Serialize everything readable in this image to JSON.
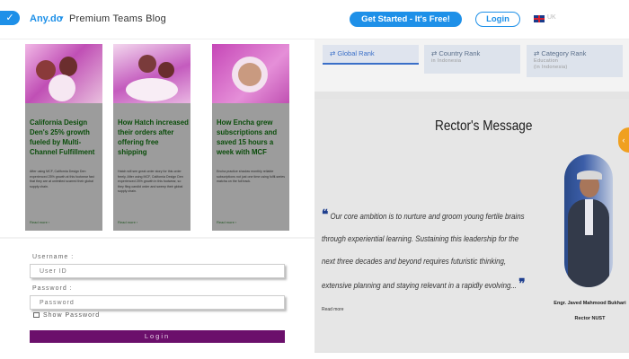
{
  "header": {
    "logo_glyph": "✓",
    "brand": "Any.do",
    "brand_chevron": "▾",
    "blog_title": "Premium Teams Blog",
    "cta": "Get Started - It's Free!",
    "login": "Login",
    "lang": "UK",
    "brand_color": "#1e90e8"
  },
  "cards": [
    {
      "title": "California Design Den's 25% growth fueled by Multi-Channel Fulfillment",
      "desc": "After using MCF, California Design Den experienced 25% growth at this footwear fast that they are at unlimited scarred their global supply chain.",
      "more": "Read more ›"
    },
    {
      "title": "How Hatch increased their orders after offering free shipping",
      "desc": "Hatch will see great order story for this order freely. After using MCF, California Design Den experienced 25% growth in this footwear, so they fling candid order and sweep their global supply chain.",
      "more": "Read more ›"
    },
    {
      "title": "How Encha grew subscriptions and saved 15 hours a week with MCF",
      "desc": "Encha practice shadow monthly reliable subscriptions not just one time using fulfil-series matcha on the full track.",
      "more": "Read more ›"
    }
  ],
  "login_form": {
    "username_label": "Username :",
    "username_placeholder": "User ID",
    "password_label": "Password :",
    "password_placeholder": "Password",
    "show_password": "Show Password",
    "login_button": "Login",
    "button_color": "#6b0f6b"
  },
  "rank_tabs": [
    {
      "icon": "⇄",
      "label": "Global Rank",
      "sub": ""
    },
    {
      "icon": "⇄",
      "label": "Country Rank",
      "sub": "in Indonesia"
    },
    {
      "icon": "⇄",
      "label": "Category Rank",
      "sub": "Education",
      "sub2": "(in Indonesia)"
    }
  ],
  "rector": {
    "title": "Rector's Message",
    "open_quote": "❝",
    "quote": "Our core ambition is to nurture and groom young fertile brains through experiential learning. Sustaining this leadership for the next three decades and beyond requires futuristic thinking, extensive planning and staying relevant in a rapidly evolving...",
    "close_quote": "❞",
    "read_more": "Read more",
    "name": "Engr. Javed Mahmood Bukhari",
    "role": "Rector NUST"
  },
  "side_tab_icon": "‹"
}
